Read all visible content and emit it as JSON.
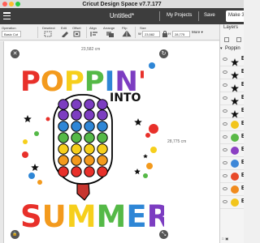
{
  "window": {
    "title": "Cricut Design Space  v7.7.177"
  },
  "header": {
    "doc_title": "Untitled*",
    "my_projects": "My Projects",
    "save": "Save",
    "make": "Make 3"
  },
  "toolbar": {
    "operation_label": "Operation",
    "operation_value": "Basic Cut",
    "deselect": "Deselect",
    "edit": "Edit",
    "offset": "Offset",
    "align": "Align",
    "arrange": "Arrange",
    "flip": "Flip",
    "size_label": "Size",
    "w_prefix": "W",
    "w_value": "23,582",
    "h_prefix": "H",
    "h_value": "28,775",
    "more": "More ▾"
  },
  "canvas": {
    "width_dim": "23,582 cm",
    "height_dim": "28,775 cm"
  },
  "artwork": {
    "line1": "POPPIN'",
    "into": "INTO",
    "line2": "SUMMER"
  },
  "layers": {
    "title": "Layers",
    "group_label": "Poppin",
    "rows": [
      {
        "color": "#111111",
        "letter": "B",
        "shape": "star"
      },
      {
        "color": "#111111",
        "letter": "B",
        "shape": "star"
      },
      {
        "color": "#111111",
        "letter": "B",
        "shape": "star"
      },
      {
        "color": "#111111",
        "letter": "B",
        "shape": "star"
      },
      {
        "color": "#111111",
        "letter": "B",
        "shape": "star"
      },
      {
        "color": "#f2c51c",
        "letter": "B",
        "shape": "dot"
      },
      {
        "color": "#5ab947",
        "letter": "B",
        "shape": "dot"
      },
      {
        "color": "#8b3fc3",
        "letter": "B",
        "shape": "dot"
      },
      {
        "color": "#3d87d8",
        "letter": "B",
        "shape": "dot"
      },
      {
        "color": "#e84a2a",
        "letter": "B",
        "shape": "dot"
      },
      {
        "color": "#f08a1d",
        "letter": "B",
        "shape": "dot"
      },
      {
        "color": "#f2c51c",
        "letter": "B",
        "shape": "dot"
      }
    ]
  },
  "colors": {
    "red": "#e8302a",
    "orange": "#f39a1d",
    "yellow": "#f6cf1c",
    "green": "#55b947",
    "blue": "#2e86d6",
    "purple": "#7c3dc1",
    "stick": "#c7352f",
    "header": "#3d3d3d"
  }
}
